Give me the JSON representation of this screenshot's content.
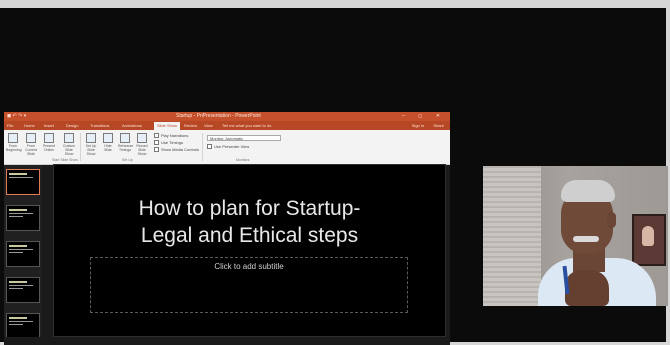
{
  "powerpoint": {
    "title_bar": {
      "quick_access": "◼ ↶ ↷ ▾",
      "document_title": "Startup - PriPresentation - PowerPoint",
      "window_controls": "– ◻ ✕"
    },
    "tabs": [
      "File",
      "Home",
      "Insert",
      "Design",
      "Transitions",
      "Animations",
      "Slide Show",
      "Review",
      "View",
      "Tell me what you want to do"
    ],
    "active_tab": "Slide Show",
    "sign_in": "Sign in",
    "share": "Share",
    "ribbon": {
      "buttons": [
        {
          "label": "From Beginning"
        },
        {
          "label": "From Current Slide"
        },
        {
          "label": "Present Online"
        },
        {
          "label": "Custom Slide Show"
        },
        {
          "label": "Set Up Slide Show"
        },
        {
          "label": "Hide Slide"
        },
        {
          "label": "Rehearse Timings"
        },
        {
          "label": "Record Slide Show"
        }
      ],
      "checkboxes": [
        "Play Narrations",
        "Use Timings",
        "Show Media Controls"
      ],
      "monitor_label": "Monitor: Automatic",
      "presenter_view": "Use Presenter View",
      "groups": [
        "Start Slide Show",
        "Set Up",
        "Monitors"
      ]
    },
    "slide": {
      "title_line1": "How to plan for Startup-",
      "title_line2": "Legal and Ethical steps",
      "subtitle_placeholder": "Click to add subtitle"
    },
    "thumbnails": [
      "1",
      "2",
      "3",
      "4",
      "5"
    ]
  },
  "video": {
    "participant": "presenter camera"
  }
}
